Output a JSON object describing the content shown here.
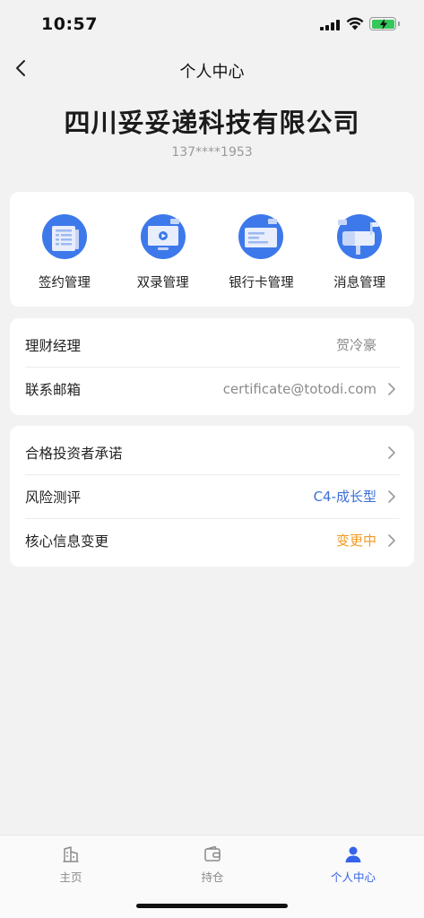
{
  "status_bar": {
    "time": "10:57"
  },
  "nav": {
    "title": "个人中心"
  },
  "profile": {
    "company": "四川妥妥递科技有限公司",
    "phone": "137****1953"
  },
  "quick_actions": [
    {
      "label": "签约管理",
      "icon": "contract-doc-icon"
    },
    {
      "label": "双录管理",
      "icon": "video-record-icon"
    },
    {
      "label": "银行卡管理",
      "icon": "bank-card-icon"
    },
    {
      "label": "消息管理",
      "icon": "mailbox-icon"
    }
  ],
  "manager_section": {
    "rows": [
      {
        "label": "理财经理",
        "value": "贺冷豪"
      },
      {
        "label": "联系邮箱",
        "value": "certificate@totodi.com"
      }
    ]
  },
  "invest_section": {
    "rows": [
      {
        "label": "合格投资者承诺",
        "value": ""
      },
      {
        "label": "风险测评",
        "value": "C4-成长型"
      },
      {
        "label": "核心信息变更",
        "value": "变更中"
      }
    ]
  },
  "tabs": [
    {
      "label": "主页",
      "icon": "building-icon"
    },
    {
      "label": "持仓",
      "icon": "wallet-icon"
    },
    {
      "label": "个人中心",
      "icon": "person-icon"
    }
  ],
  "colors": {
    "accent": "#3563e9",
    "risk_level": "#3b6fd8",
    "pending_status": "#f39a21",
    "background": "#f2f2f3"
  }
}
